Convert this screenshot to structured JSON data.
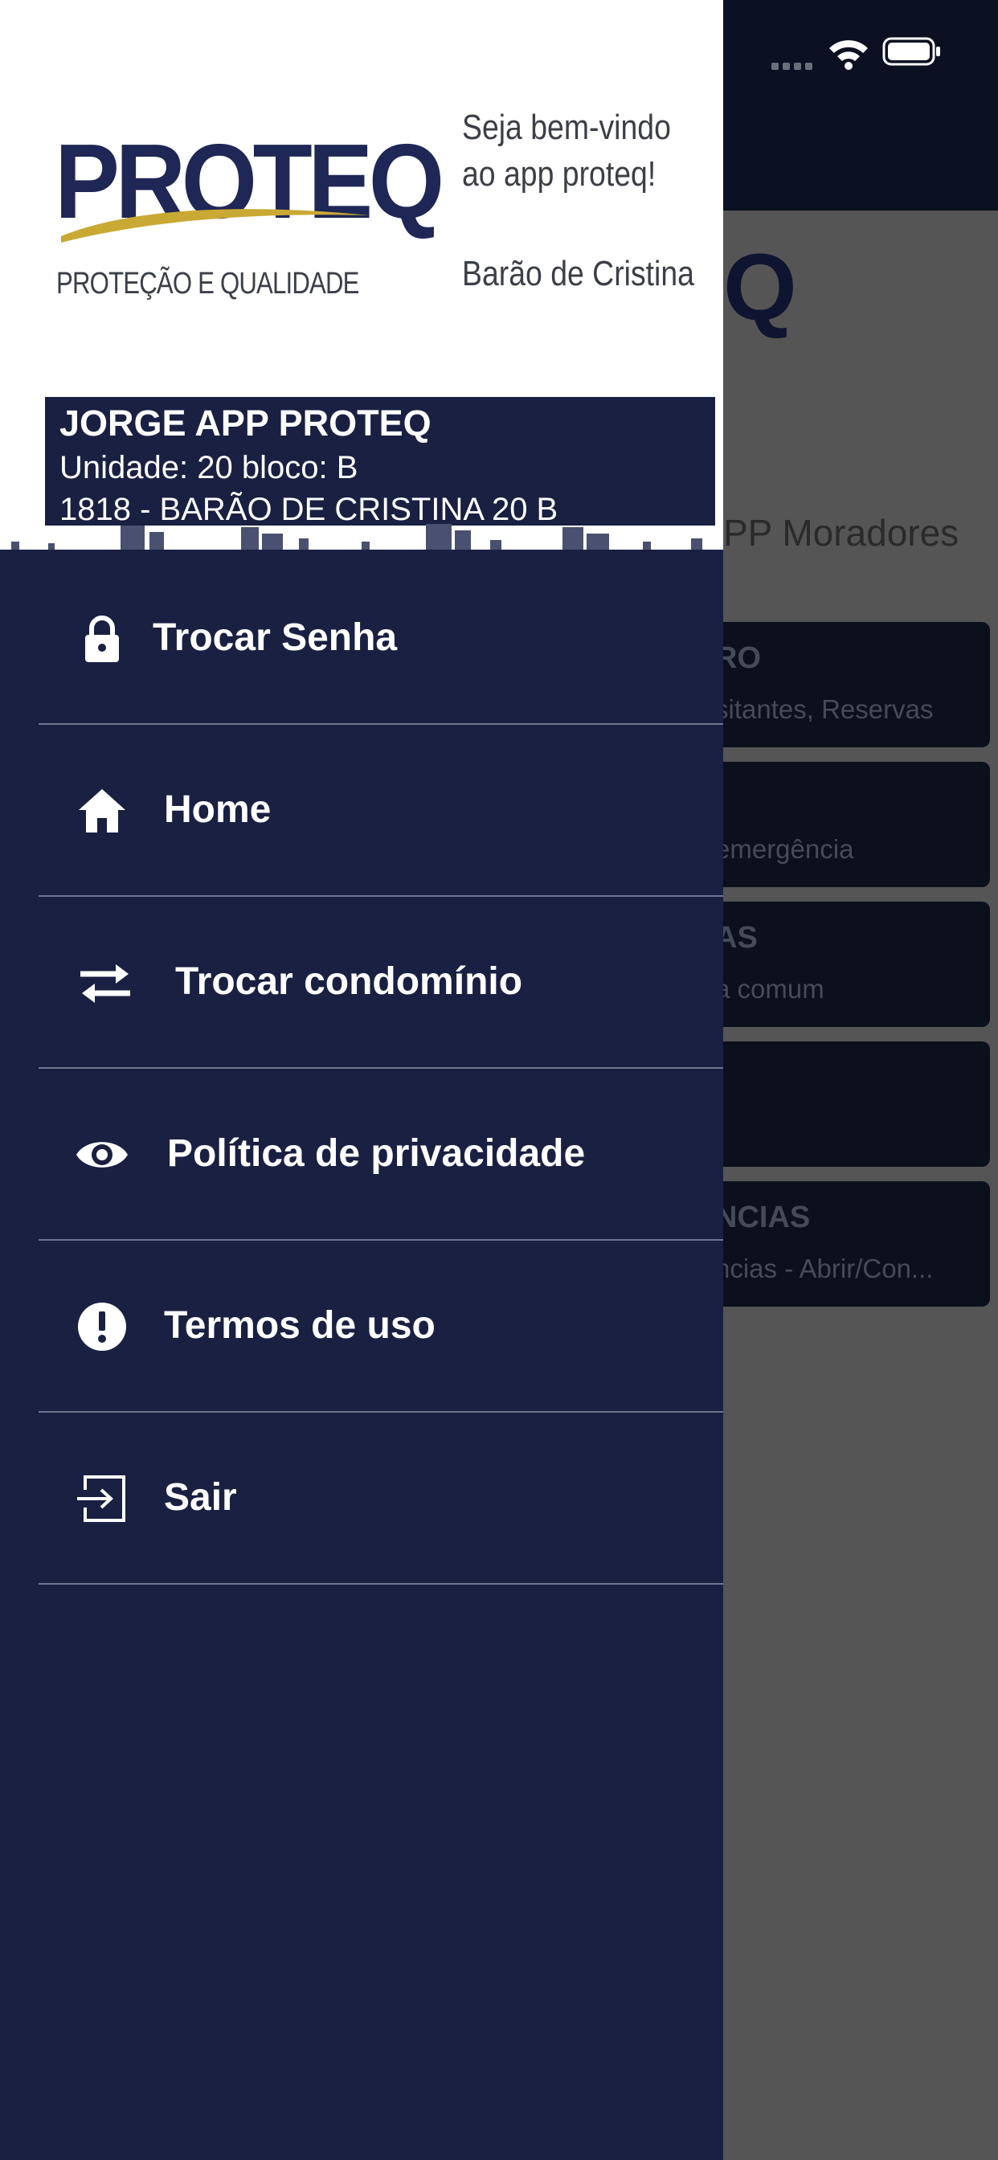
{
  "drawer": {
    "brand": {
      "name": "PROTEQ",
      "tagline": "PROTEÇÃO E QUALIDADE"
    },
    "welcome": {
      "line1": "Seja bem-vindo",
      "line2": "ao app proteq!",
      "location": "Barão de Cristina"
    },
    "user": {
      "name": "JORGE APP PROTEQ",
      "unit": "Unidade: 20 bloco: B",
      "condo": "1818 - BARÃO DE CRISTINA 20 B"
    },
    "menu": [
      {
        "label": "Trocar Senha",
        "icon": "lock-icon"
      },
      {
        "label": "Home",
        "icon": "home-icon"
      },
      {
        "label": "Trocar condomínio",
        "icon": "swap-icon"
      },
      {
        "label": "Política de privacidade",
        "icon": "eye-icon"
      },
      {
        "label": "Termos de uso",
        "icon": "alert-circle-icon"
      },
      {
        "label": "Sair",
        "icon": "logout-icon"
      }
    ]
  },
  "background": {
    "logo_fragment": "Q",
    "subtitle": "PP Moradores",
    "cards": [
      {
        "title": "RO",
        "subtitle": "sitantes, Reservas"
      },
      {
        "title": "",
        "subtitle": "emergência"
      },
      {
        "title": "AS",
        "subtitle": "a comum"
      },
      {
        "title": "",
        "subtitle": ""
      },
      {
        "title": "NCIAS",
        "subtitle": "ncias - Abrir/Con..."
      }
    ]
  },
  "colors": {
    "drawer_bg": "#192042",
    "header_dark": "#0b1022",
    "overlay": "#555555",
    "divider": "#6f7690"
  }
}
